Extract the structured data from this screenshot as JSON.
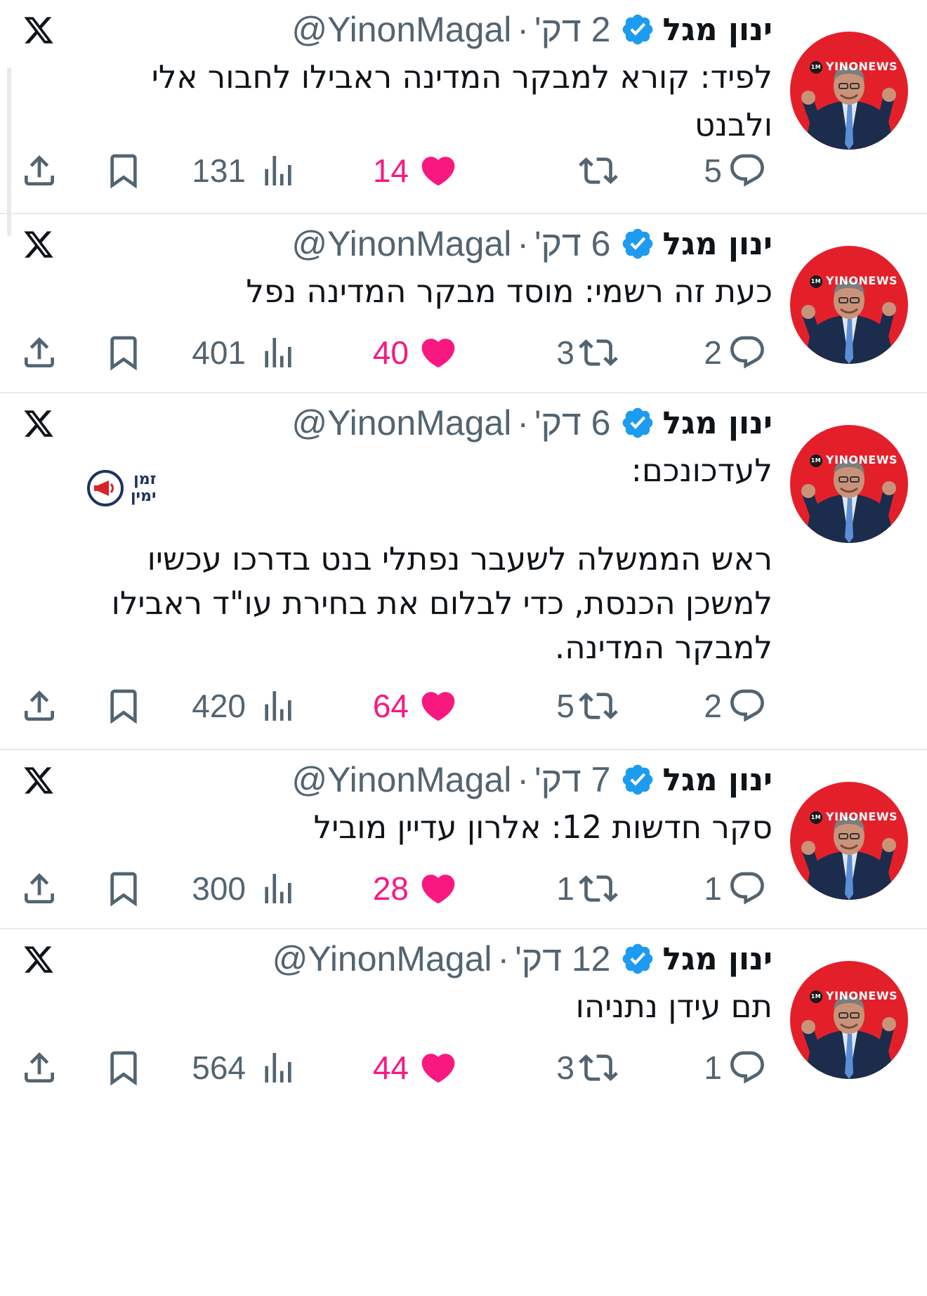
{
  "author": {
    "name": "ינון מגל",
    "handle": "@YinonMagal",
    "avatar_brand": "YINONEWS",
    "avatar_badge": "1M",
    "verified": true
  },
  "colors": {
    "verified": "#1d9bf0",
    "like": "#f91880",
    "muted": "#536471",
    "avatar_bg": "#e3202a"
  },
  "icons": [
    "x-logo-icon",
    "verified-icon",
    "reply-icon",
    "retweet-icon",
    "like-icon",
    "views-icon",
    "bookmark-icon",
    "share-icon"
  ],
  "tweets": [
    {
      "time": "2 דק'",
      "lines": [
        "לפיד: קורא למבקר המדינה ראבילו לחבור אלי",
        "ולבנט"
      ],
      "replies": "5",
      "retweets": "",
      "likes": "14",
      "views": "131"
    },
    {
      "time": "6 דק'",
      "lines": [
        "כעת זה רשמי: מוסד מבקר המדינה נפל"
      ],
      "replies": "2",
      "retweets": "3",
      "likes": "40",
      "views": "401"
    },
    {
      "time": "6 דק'",
      "lines": [
        "לעדכונכם:",
        "ראש הממשלה לשעבר נפתלי בנט בדרכו עכשיו",
        "למשכן הכנסת, כדי לבלום את בחירת עו\"ד ראבילו",
        "למבקר המדינה."
      ],
      "logo_text_1": "זמן",
      "logo_text_2": "ימין",
      "replies": "2",
      "retweets": "5",
      "likes": "64",
      "views": "420"
    },
    {
      "time": "7 דק'",
      "lines": [
        "סקר חדשות 12: אלרון עדיין מוביל"
      ],
      "replies": "1",
      "retweets": "1",
      "likes": "28",
      "views": "300"
    },
    {
      "time": "12 דק'",
      "lines": [
        "תם עידן נתניהו"
      ],
      "replies": "1",
      "retweets": "3",
      "likes": "44",
      "views": "564"
    }
  ]
}
